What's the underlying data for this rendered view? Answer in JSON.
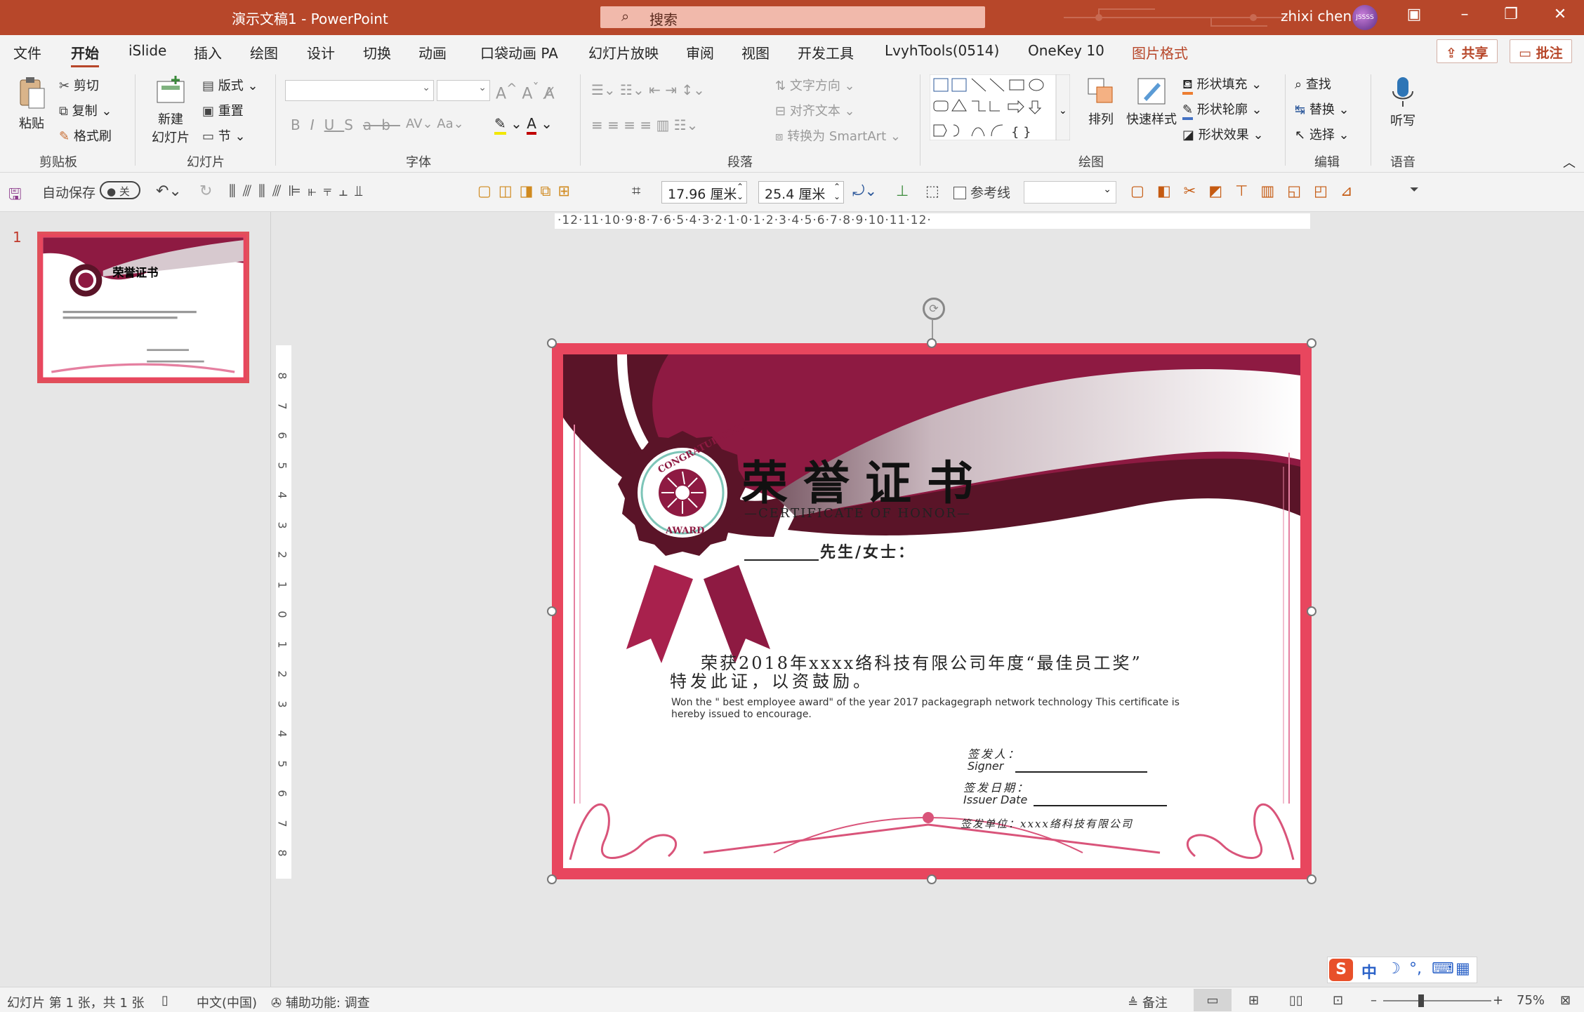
{
  "titlebar": {
    "title": "演示文稿1  -  PowerPoint",
    "search": "搜索",
    "user": "zhixi chen",
    "avatar_text": "JSSSS"
  },
  "menu": {
    "tabs": [
      "文件",
      "开始",
      "iSlide",
      "插入",
      "绘图",
      "设计",
      "切换",
      "动画",
      "口袋动画 PA",
      "幻灯片放映",
      "审阅",
      "视图",
      "开发工具",
      "LvyhTools(0514)",
      "OneKey 10",
      "图片格式"
    ],
    "active": "开始",
    "share": "共享",
    "comment": "批注"
  },
  "ribbon": {
    "clipboard": {
      "label": "剪贴板",
      "paste": "粘贴",
      "cut": "剪切",
      "copy": "复制",
      "format_painter": "格式刷"
    },
    "slides": {
      "label": "幻灯片",
      "new_slide_line1": "新建",
      "new_slide_line2": "幻灯片",
      "layout": "版式",
      "reset": "重置",
      "section": "节"
    },
    "font": {
      "label": "字体"
    },
    "paragraph": {
      "label": "段落",
      "text_direction": "文字方向",
      "align_text": "对齐文本",
      "smartart": "转换为 SmartArt"
    },
    "drawing": {
      "label": "绘图",
      "arrange": "排列",
      "quick_styles": "快速样式",
      "shape_fill": "形状填充",
      "shape_outline": "形状轮廓",
      "shape_effects": "形状效果"
    },
    "editing": {
      "label": "编辑",
      "find": "查找",
      "replace": "替换",
      "select": "选择"
    },
    "voice": {
      "label": "语音",
      "dictate": "听写"
    }
  },
  "qat": {
    "autosave": "自动保存",
    "toggle": "关",
    "height": "17.96 厘米",
    "width": "25.4 厘米",
    "guides": "参考线"
  },
  "ruler": {
    "h_ticks": "·12·11·10·9·8·7·6·5·4·3·2·1·0·1·2·3·4·5·6·7·8·9·10·11·12·",
    "v_ticks": [
      "8",
      "7",
      "6",
      "5",
      "4",
      "3",
      "2",
      "1",
      "0",
      "1",
      "2",
      "3",
      "4",
      "5",
      "6",
      "7",
      "8"
    ]
  },
  "thumbnails": {
    "slide_number": "1"
  },
  "certificate": {
    "title": "荣誉证书",
    "subtitle": "—CERTIFICATE OF HONOR—",
    "salutation": "先生/女士：",
    "badge_top": "CONGRATULATION",
    "badge_bottom": "AWARD",
    "body_cn_1": "荣获2018年xxxx络科技有限公司年度“最佳员工奖”",
    "body_cn_2": "特发此证，以资鼓励。",
    "body_en": "Won the \" best employee award\" of the year 2017 packagegraph network technology This certificate is hereby issued to encourage.",
    "signer_cn": "签发人：",
    "signer_en": "Signer",
    "date_cn": "签发日期：",
    "date_en": "Issuer Date",
    "unit": "签发单位：xxxx络科技有限公司"
  },
  "status": {
    "slide_info": "幻灯片 第 1 张，共 1 张",
    "language": "中文(中国)",
    "accessibility": "辅助功能: 调查",
    "notes": "备注",
    "zoom": "75%"
  },
  "ime": {
    "lang": "中"
  },
  "colors": {
    "accent": "#b7472a",
    "frame": "#e8465e",
    "wine": "#8e1a42",
    "dark_wine": "#5a1428"
  }
}
